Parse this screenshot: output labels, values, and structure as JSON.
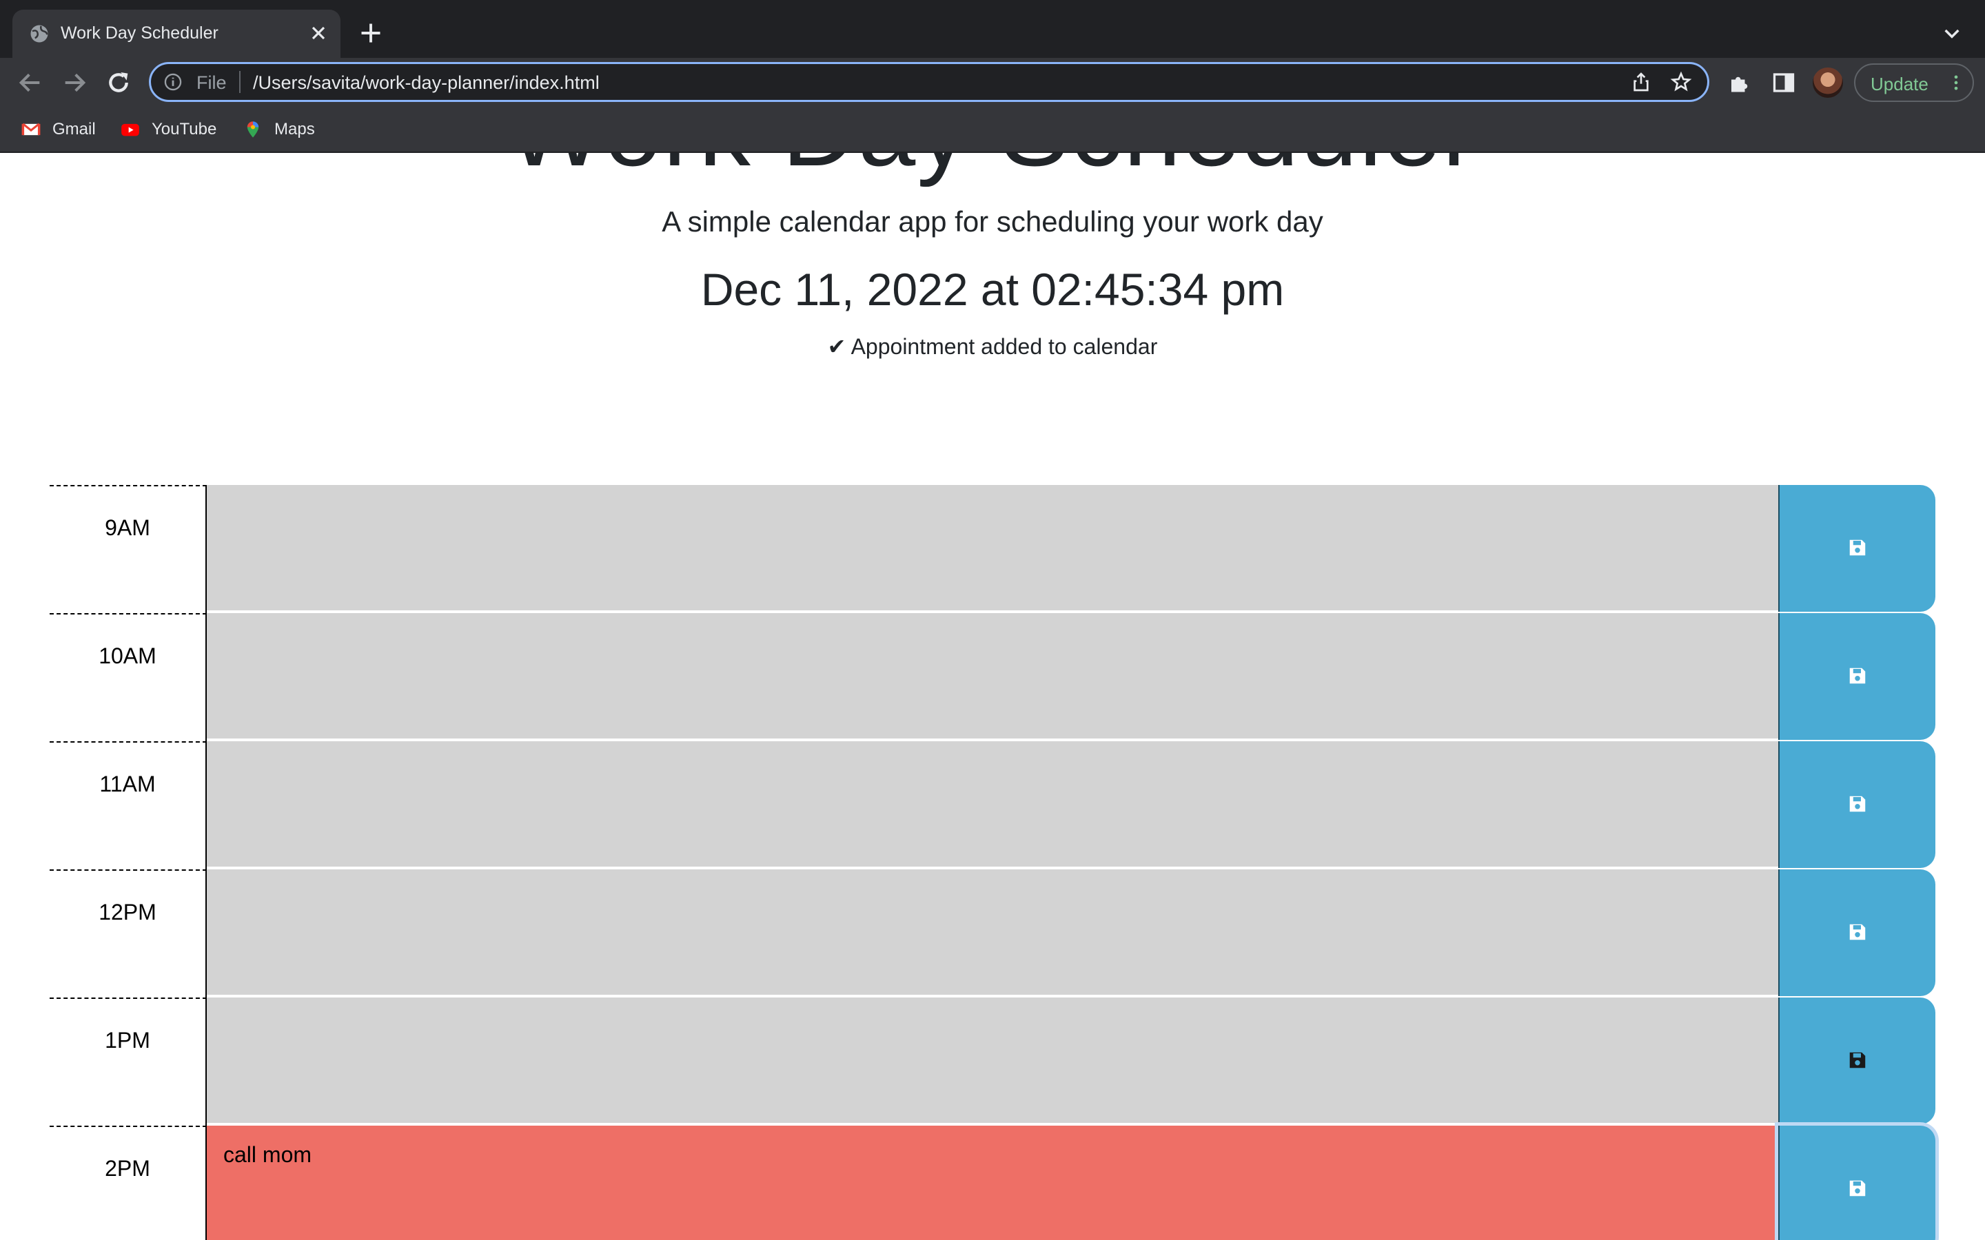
{
  "browser": {
    "tab_title": "Work Day Scheduler",
    "omnibox_scheme": "File",
    "url": "/Users/savita/work-day-planner/index.html",
    "update_label": "Update",
    "bookmarks": [
      {
        "label": "Gmail",
        "icon": "gmail-icon"
      },
      {
        "label": "YouTube",
        "icon": "youtube-icon"
      },
      {
        "label": "Maps",
        "icon": "maps-icon"
      }
    ]
  },
  "header": {
    "title": "Work Day Scheduler",
    "subtitle": "A simple calendar app for scheduling your work day",
    "current_day": "Dec 11, 2022 at 02:45:34 pm",
    "notice": "✔ Appointment added to calendar"
  },
  "timeblocks": [
    {
      "hour": "9AM",
      "text": "",
      "state": "past",
      "save_icon": "save-icon"
    },
    {
      "hour": "10AM",
      "text": "",
      "state": "past",
      "save_icon": "save-icon"
    },
    {
      "hour": "11AM",
      "text": "",
      "state": "past",
      "save_icon": "save-icon"
    },
    {
      "hour": "12PM",
      "text": "",
      "state": "past",
      "save_icon": "save-icon"
    },
    {
      "hour": "1PM",
      "text": "",
      "state": "past",
      "save_icon": "save-icon"
    },
    {
      "hour": "2PM",
      "text": "call mom",
      "state": "present",
      "save_icon": "save-icon"
    }
  ],
  "colors": {
    "past": "#d3d3d3",
    "present": "#ee6f66",
    "save_button": "#4aabd4",
    "chrome_dark": "#202124",
    "chrome_toolbar": "#35363a",
    "omnibox_focus": "#8ab4f8"
  }
}
